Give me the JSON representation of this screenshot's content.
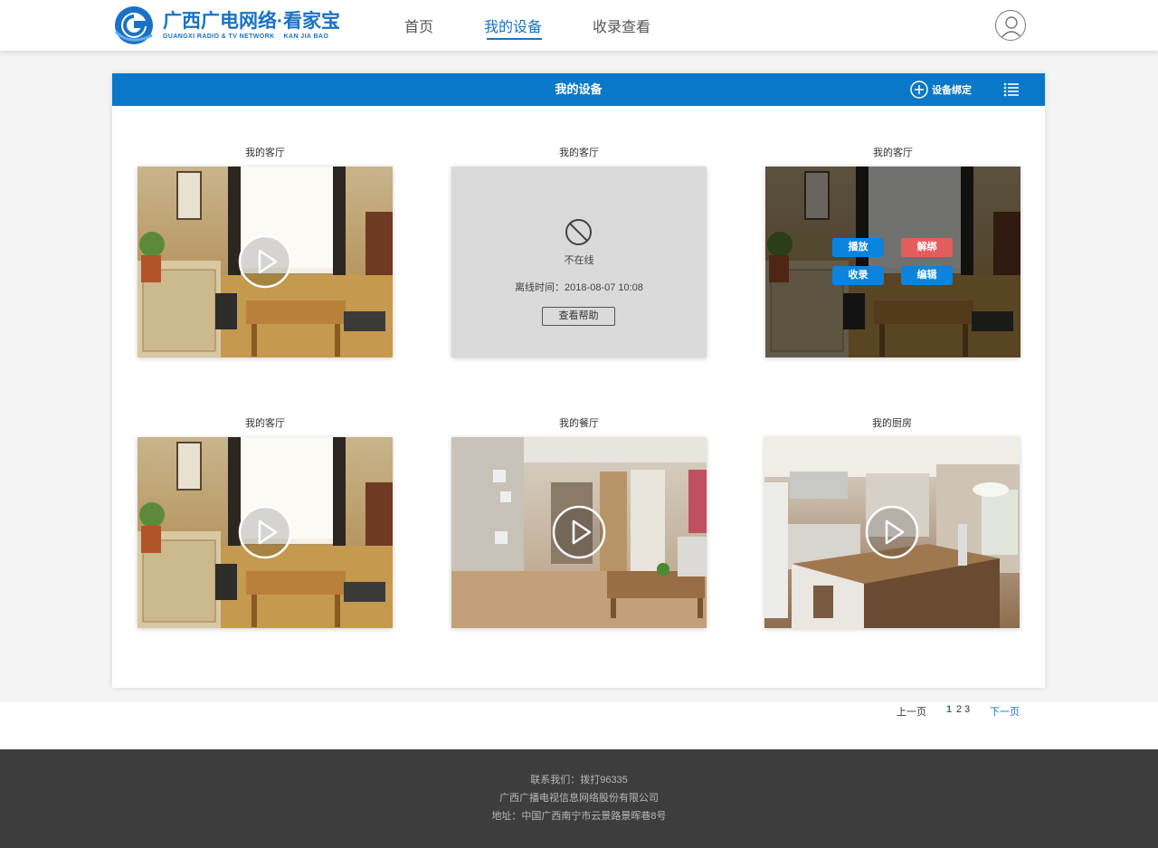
{
  "header": {
    "logo_cn": "广西广电网络·看家宝",
    "logo_en_left": "GUANGXI RADIO & TV NETWORK",
    "logo_en_right": "KAN JIA BAO",
    "nav": [
      {
        "label": "首页",
        "active": false
      },
      {
        "label": "我的设备",
        "active": true
      },
      {
        "label": "收录查看",
        "active": false
      }
    ]
  },
  "panel": {
    "title": "我的设备",
    "bind_label": "设备绑定"
  },
  "devices": [
    {
      "name": "我的客厅",
      "state": "play",
      "scene": "living-room"
    },
    {
      "name": "我的客厅",
      "state": "offline",
      "status": "不在线",
      "offline_time": "离线时间：2018-08-07 10:08",
      "help_label": "查看帮助"
    },
    {
      "name": "我的客厅",
      "state": "actions",
      "scene": "living-room",
      "actions": {
        "play": "播放",
        "unbind": "解绑",
        "record": "收录",
        "edit": "编辑"
      }
    },
    {
      "name": "我的客厅",
      "state": "play",
      "scene": "living-room"
    },
    {
      "name": "我的餐厅",
      "state": "play",
      "scene": "dining-room"
    },
    {
      "name": "我的厨房",
      "state": "play",
      "scene": "kitchen"
    }
  ],
  "pagination": {
    "prev": "上一页",
    "pages": [
      "1",
      "2",
      "3"
    ],
    "current": "1",
    "next": "下一页"
  },
  "footer": {
    "contact": "联系我们：拨打96335",
    "company": "广西广播电视信息网络股份有限公司",
    "address": "地址：中国广西南宁市云景路景晖巷8号"
  },
  "colors": {
    "brand": "#1a72c4",
    "panel_header": "#0a78c9",
    "action_blue": "#0a84de",
    "action_red": "#e35d5d",
    "footer_bg": "#3d3d3d"
  }
}
